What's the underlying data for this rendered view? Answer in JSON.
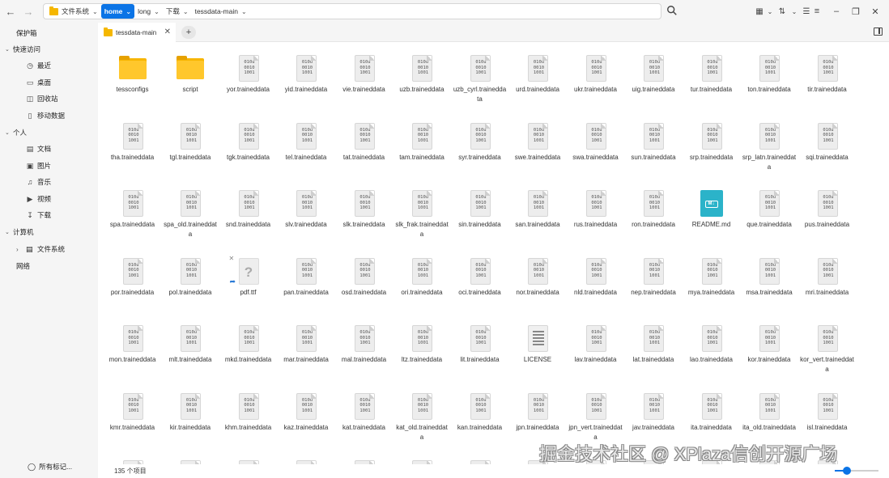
{
  "toolbar": {
    "back_icon": "back-arrow-icon",
    "forward_icon": "forward-arrow-icon",
    "breadcrumbs": [
      {
        "label": "文件系统",
        "icon": "folder-icon"
      },
      {
        "label": "home",
        "active": true
      },
      {
        "label": "long"
      },
      {
        "label": "下载"
      },
      {
        "label": "tessdata-main"
      }
    ],
    "view_icons": [
      "grid-view-icon",
      "sort-icon",
      "list-view-icon"
    ],
    "window_controls": [
      "menu-icon",
      "minimize-icon",
      "maximize-icon",
      "close-icon"
    ]
  },
  "sidebar": {
    "header": "保护箱",
    "quick_access": {
      "label": "快速访问",
      "items": [
        {
          "label": "最近",
          "icon": "clock-icon"
        },
        {
          "label": "桌面",
          "icon": "desktop-icon"
        },
        {
          "label": "回收站",
          "icon": "trash-icon"
        },
        {
          "label": "移动数据",
          "icon": "phone-icon"
        }
      ]
    },
    "personal": {
      "label": "个人",
      "items": [
        {
          "label": "文档",
          "icon": "document-icon"
        },
        {
          "label": "图片",
          "icon": "image-icon"
        },
        {
          "label": "音乐",
          "icon": "music-icon"
        },
        {
          "label": "视频",
          "icon": "video-icon"
        },
        {
          "label": "下载",
          "icon": "download-icon"
        }
      ]
    },
    "computer": {
      "label": "计算机",
      "items": [
        {
          "label": "文件系统",
          "icon": "drive-icon"
        }
      ]
    },
    "network": "网络",
    "all_tags": "所有标记..."
  },
  "tabs": [
    {
      "label": "tessdata-main"
    }
  ],
  "files": [
    {
      "name": "tessconfigs",
      "type": "folder"
    },
    {
      "name": "script",
      "type": "folder"
    },
    {
      "name": "yor.traineddata",
      "type": "binary"
    },
    {
      "name": "yid.traineddata",
      "type": "binary"
    },
    {
      "name": "vie.traineddata",
      "type": "binary"
    },
    {
      "name": "uzb.traineddata",
      "type": "binary"
    },
    {
      "name": "uzb_cyrl.traineddata",
      "type": "binary"
    },
    {
      "name": "urd.traineddata",
      "type": "binary"
    },
    {
      "name": "ukr.traineddata",
      "type": "binary"
    },
    {
      "name": "uig.traineddata",
      "type": "binary"
    },
    {
      "name": "tur.traineddata",
      "type": "binary"
    },
    {
      "name": "ton.traineddata",
      "type": "binary"
    },
    {
      "name": "tir.traineddata",
      "type": "binary"
    },
    {
      "name": "tha.traineddata",
      "type": "binary"
    },
    {
      "name": "tgl.traineddata",
      "type": "binary"
    },
    {
      "name": "tgk.traineddata",
      "type": "binary"
    },
    {
      "name": "tel.traineddata",
      "type": "binary"
    },
    {
      "name": "tat.traineddata",
      "type": "binary"
    },
    {
      "name": "tam.traineddata",
      "type": "binary"
    },
    {
      "name": "syr.traineddata",
      "type": "binary"
    },
    {
      "name": "swe.traineddata",
      "type": "binary"
    },
    {
      "name": "swa.traineddata",
      "type": "binary"
    },
    {
      "name": "sun.traineddata",
      "type": "binary"
    },
    {
      "name": "srp.traineddata",
      "type": "binary"
    },
    {
      "name": "srp_latn.traineddata",
      "type": "binary"
    },
    {
      "name": "sqi.traineddata",
      "type": "binary"
    },
    {
      "name": "spa.traineddata",
      "type": "binary"
    },
    {
      "name": "spa_old.traineddata",
      "type": "binary"
    },
    {
      "name": "snd.traineddata",
      "type": "binary"
    },
    {
      "name": "slv.traineddata",
      "type": "binary"
    },
    {
      "name": "slk.traineddata",
      "type": "binary"
    },
    {
      "name": "slk_frak.traineddata",
      "type": "binary"
    },
    {
      "name": "sin.traineddata",
      "type": "binary"
    },
    {
      "name": "san.traineddata",
      "type": "binary"
    },
    {
      "name": "rus.traineddata",
      "type": "binary"
    },
    {
      "name": "ron.traineddata",
      "type": "binary"
    },
    {
      "name": "README.md",
      "type": "markdown"
    },
    {
      "name": "que.traineddata",
      "type": "binary"
    },
    {
      "name": "pus.traineddata",
      "type": "binary"
    },
    {
      "name": "por.traineddata",
      "type": "binary"
    },
    {
      "name": "pol.traineddata",
      "type": "binary"
    },
    {
      "name": "pdf.ttf",
      "type": "unknown"
    },
    {
      "name": "pan.traineddata",
      "type": "binary"
    },
    {
      "name": "osd.traineddata",
      "type": "binary"
    },
    {
      "name": "ori.traineddata",
      "type": "binary"
    },
    {
      "name": "oci.traineddata",
      "type": "binary"
    },
    {
      "name": "nor.traineddata",
      "type": "binary"
    },
    {
      "name": "nld.traineddata",
      "type": "binary"
    },
    {
      "name": "nep.traineddata",
      "type": "binary"
    },
    {
      "name": "mya.traineddata",
      "type": "binary"
    },
    {
      "name": "msa.traineddata",
      "type": "binary"
    },
    {
      "name": "mri.traineddata",
      "type": "binary"
    },
    {
      "name": "mon.traineddata",
      "type": "binary"
    },
    {
      "name": "mlt.traineddata",
      "type": "binary"
    },
    {
      "name": "mkd.traineddata",
      "type": "binary"
    },
    {
      "name": "mar.traineddata",
      "type": "binary"
    },
    {
      "name": "mal.traineddata",
      "type": "binary"
    },
    {
      "name": "ltz.traineddata",
      "type": "binary"
    },
    {
      "name": "lit.traineddata",
      "type": "binary"
    },
    {
      "name": "LICENSE",
      "type": "text"
    },
    {
      "name": "lav.traineddata",
      "type": "binary"
    },
    {
      "name": "lat.traineddata",
      "type": "binary"
    },
    {
      "name": "lao.traineddata",
      "type": "binary"
    },
    {
      "name": "kor.traineddata",
      "type": "binary"
    },
    {
      "name": "kor_vert.traineddata",
      "type": "binary"
    },
    {
      "name": "kmr.traineddata",
      "type": "binary"
    },
    {
      "name": "kir.traineddata",
      "type": "binary"
    },
    {
      "name": "khm.traineddata",
      "type": "binary"
    },
    {
      "name": "kaz.traineddata",
      "type": "binary"
    },
    {
      "name": "kat.traineddata",
      "type": "binary"
    },
    {
      "name": "kat_old.traineddata",
      "type": "binary"
    },
    {
      "name": "kan.traineddata",
      "type": "binary"
    },
    {
      "name": "jpn.traineddata",
      "type": "binary"
    },
    {
      "name": "jpn_vert.traineddata",
      "type": "binary"
    },
    {
      "name": "jav.traineddata",
      "type": "binary"
    },
    {
      "name": "ita.traineddata",
      "type": "binary"
    },
    {
      "name": "ita_old.traineddata",
      "type": "binary"
    },
    {
      "name": "isl.traineddata",
      "type": "binary"
    }
  ],
  "binary_glyph": "010u\n0010\n1001",
  "status": {
    "item_count": "135 个项目",
    "zoom_level": 0.27
  },
  "watermark": "掘金技术社区 @ XPlaza信创开源广场",
  "colors": {
    "accent": "#0b74e6",
    "folder": "#ffc72c",
    "markdown": "#2bb3c9"
  }
}
